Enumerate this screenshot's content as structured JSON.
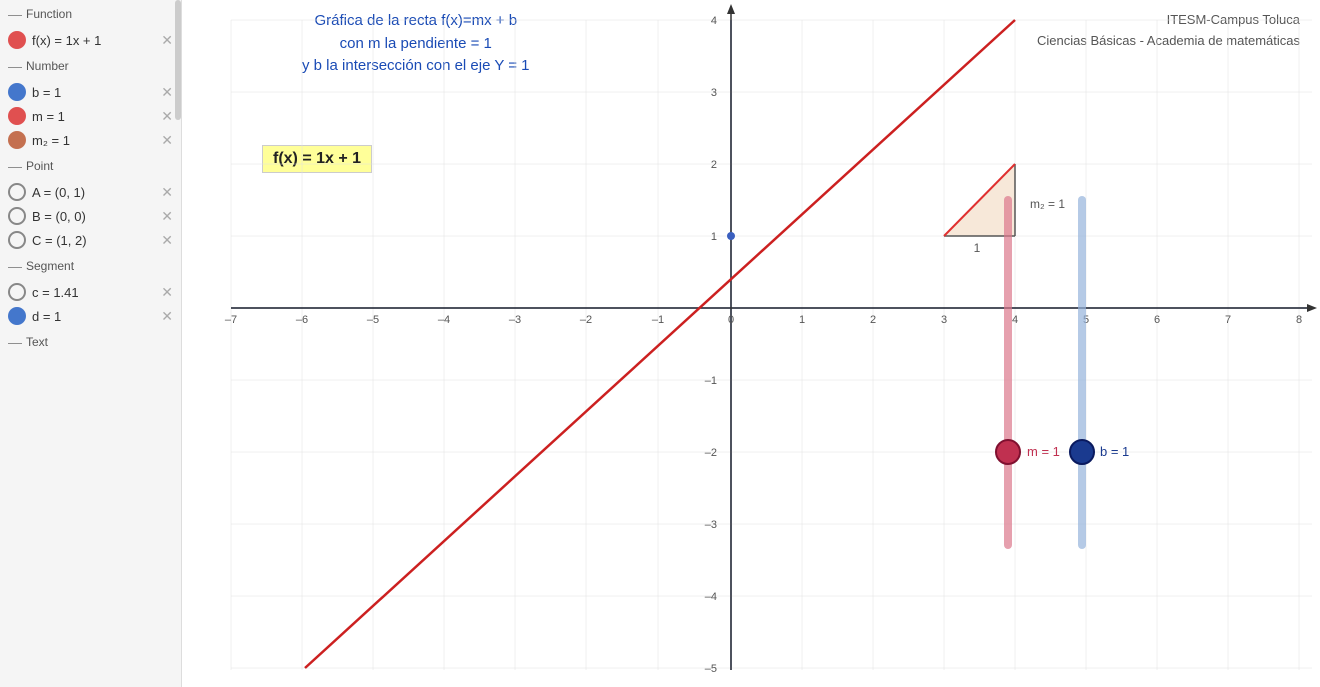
{
  "sidebar": {
    "sections": [
      {
        "label": "Function",
        "items": [
          {
            "type": "circle-red",
            "text": "f(x) = 1x + 1",
            "id": "fx"
          }
        ]
      },
      {
        "label": "Number",
        "items": [
          {
            "type": "circle-blue",
            "text": "b = 1",
            "id": "b"
          },
          {
            "type": "circle-red",
            "text": "m = 1",
            "id": "m"
          },
          {
            "type": "circle-pinkbrown",
            "text": "m₂ = 1",
            "id": "m2"
          }
        ]
      },
      {
        "label": "Point",
        "items": [
          {
            "type": "circle-outline",
            "text": "A = (0, 1)",
            "id": "A"
          },
          {
            "type": "circle-outline",
            "text": "B = (0, 0)",
            "id": "B"
          },
          {
            "type": "circle-outline",
            "text": "C = (1, 2)",
            "id": "C"
          }
        ]
      },
      {
        "label": "Segment",
        "items": [
          {
            "type": "circle-outline",
            "text": "c = 1.41",
            "id": "c"
          },
          {
            "type": "circle-blue",
            "text": "d = 1",
            "id": "d"
          }
        ]
      },
      {
        "label": "Text",
        "items": []
      }
    ]
  },
  "description": {
    "line1": "Gráfica de la recta f(x)=mx + b",
    "line2": "con m la pendiente = 1",
    "line3": "y b la intersección con el eje Y = 1"
  },
  "institution": {
    "line1": "ITESM-Campus Toluca",
    "line2": "Ciencias Básicas - Academia de matemáticas"
  },
  "formula": "f(x) = 1x + 1",
  "graph": {
    "xmin": -7,
    "xmax": 8,
    "ymin": -5,
    "ymax": 4,
    "slope_label": "m₂ = 1",
    "run_label": "1",
    "m_label": "m = 1",
    "b_label": "b = 1"
  }
}
